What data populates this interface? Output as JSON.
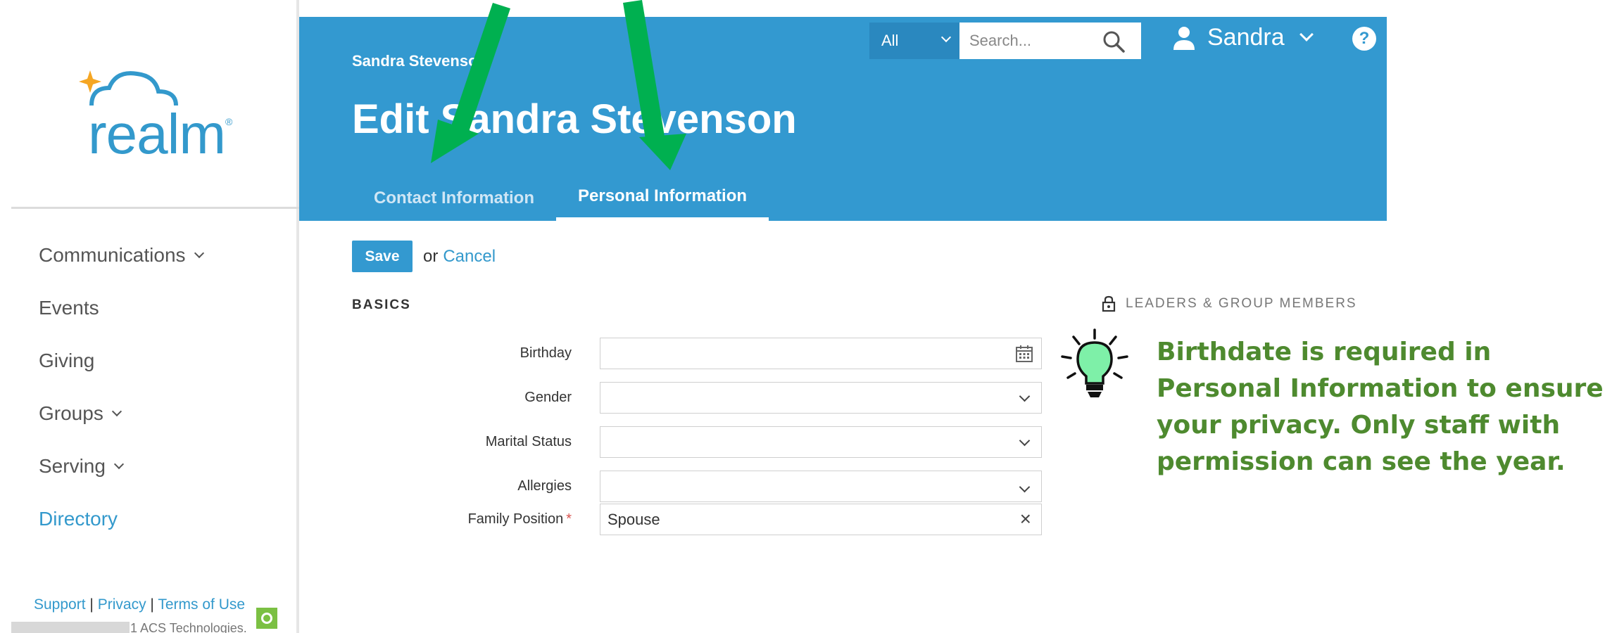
{
  "sidebar": {
    "logo_text": "realm",
    "logo_mark": "®",
    "items": [
      {
        "label": "Communications",
        "chevron": true
      },
      {
        "label": "Events",
        "chevron": false
      },
      {
        "label": "Giving",
        "chevron": false
      },
      {
        "label": "Groups",
        "chevron": true
      },
      {
        "label": "Serving",
        "chevron": true
      },
      {
        "label": "Directory",
        "chevron": false,
        "active": true
      }
    ],
    "footer": {
      "support": "Support",
      "sep1": "|",
      "privacy": "Privacy",
      "sep2": "|",
      "terms": "Terms of Use",
      "copyright": "1 ACS Technologies."
    }
  },
  "header": {
    "breadcrumb": "Sandra Stevenson",
    "title": "Edit Sandra Stevenson",
    "tabs": [
      {
        "label": "Contact Information",
        "active": false
      },
      {
        "label": "Personal Information",
        "active": true
      }
    ],
    "search": {
      "scope": "All",
      "placeholder": "Search..."
    },
    "user": {
      "name": "Sandra"
    },
    "help_label": "?"
  },
  "actions": {
    "save_label": "Save",
    "or_text": "or",
    "cancel_label": "Cancel"
  },
  "form": {
    "section_title": "BASICS",
    "fields": {
      "birthday": {
        "label": "Birthday",
        "value": ""
      },
      "gender": {
        "label": "Gender",
        "value": ""
      },
      "marital_status": {
        "label": "Marital Status",
        "value": ""
      },
      "allergies": {
        "label": "Allergies",
        "value": ""
      },
      "family_position": {
        "label": "Family Position",
        "required_mark": "*",
        "value": "Spouse"
      }
    }
  },
  "privacy": {
    "label": "LEADERS & GROUP MEMBERS"
  },
  "tip": {
    "text": "Birthdate is required in Personal Information to ensure your privacy. Only staff with permission can see the year."
  },
  "colors": {
    "brand_blue": "#3399d0",
    "tip_green": "#4e8a2f",
    "arrow_green": "#00b050"
  }
}
